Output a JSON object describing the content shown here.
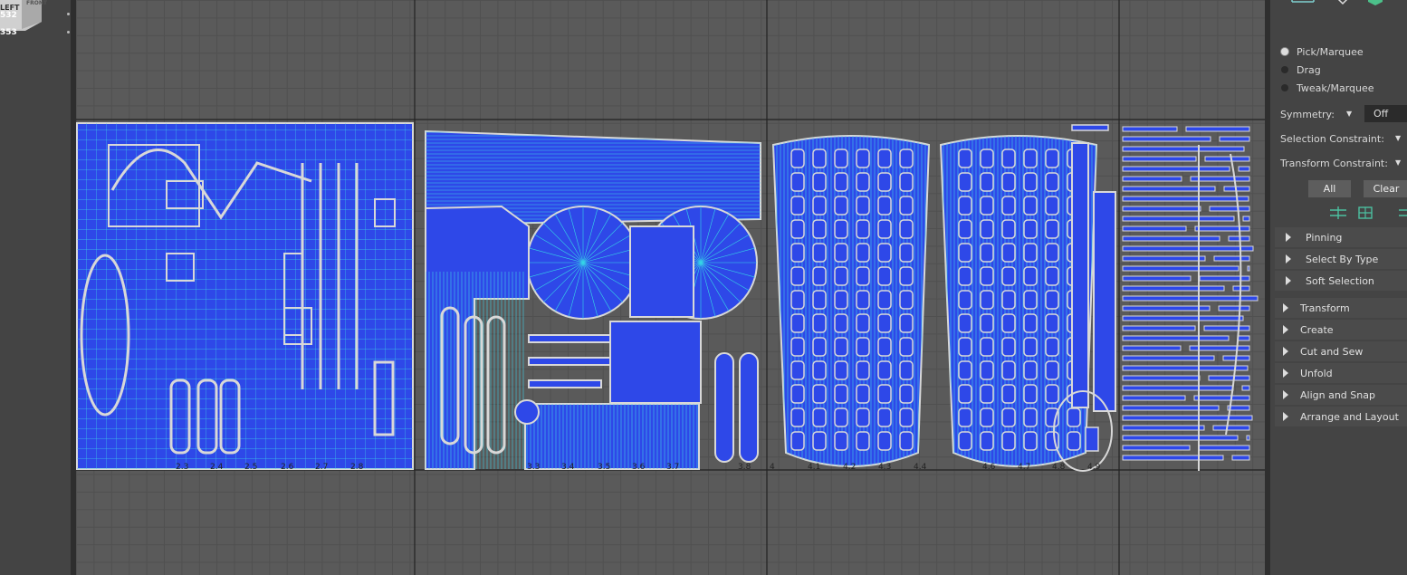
{
  "nav_cube": {
    "left_label": "LEFT",
    "front_label": "FRONT",
    "readout_1": "532",
    "readout_2": "353"
  },
  "tool_panel": {
    "modes": [
      {
        "label": "Pick/Marquee",
        "selected": true
      },
      {
        "label": "Drag",
        "selected": false
      },
      {
        "label": "Tweak/Marquee",
        "selected": false
      }
    ],
    "symmetry_label": "Symmetry:",
    "symmetry_value": "Off",
    "selection_constraint_label": "Selection Constraint:",
    "transform_constraint_label": "Transform Constraint:",
    "all_button": "All",
    "clear_button": "Clear",
    "subsections": [
      "Pinning",
      "Select By Type",
      "Soft Selection"
    ],
    "sections": [
      "Transform",
      "Create",
      "Cut and Sew",
      "Unfold",
      "Align and Snap",
      "Arrange and Layout"
    ]
  },
  "uv_axis": {
    "labels": [
      "2.3",
      "2.4",
      "2.5",
      "2.6",
      "2.7",
      "2.8",
      "3.3",
      "3.4",
      "3.5",
      "3.6",
      "3.7",
      "3.8",
      "4",
      "4.1",
      "4.2",
      "4.3",
      "4.4",
      "4.6",
      "4.7",
      "4.8",
      "4.9"
    ]
  },
  "colors": {
    "uv_fill": "#2e48e8",
    "uv_wire": "#36d6e6",
    "uv_border": "#d8d8d8",
    "grid_bg": "#5a5a5a"
  }
}
